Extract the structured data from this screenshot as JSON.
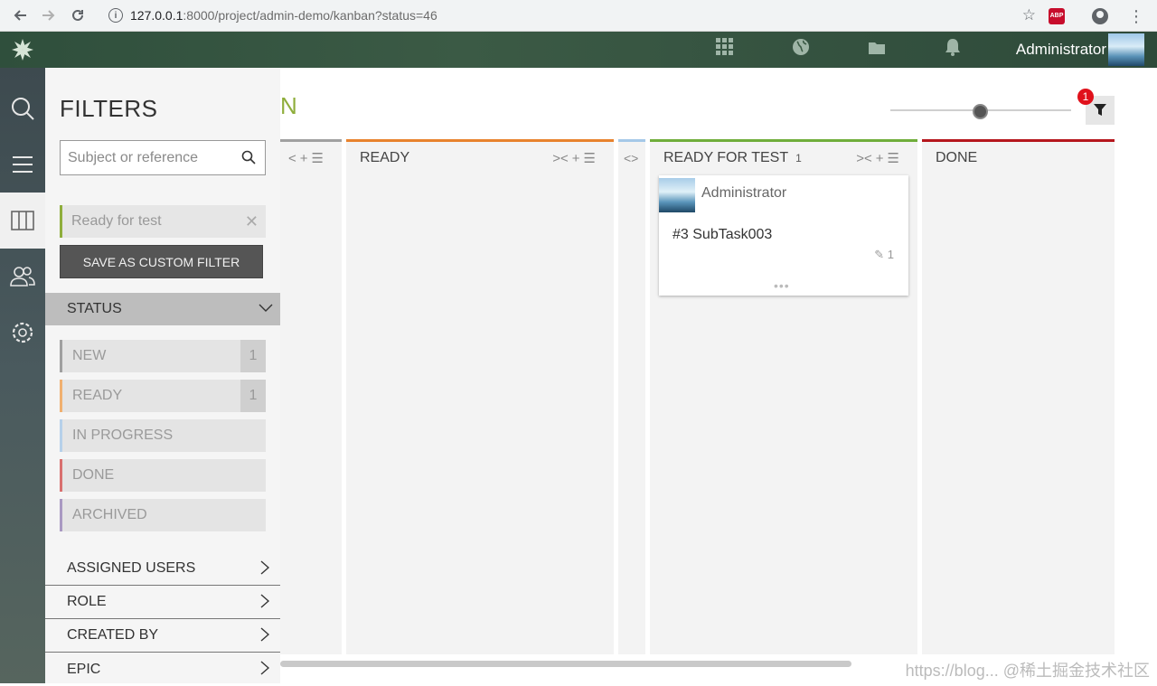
{
  "browser": {
    "url_host": "127.0.0.1",
    "url_path": ":8000/project/admin-demo/kanban?status=46",
    "info_icon": "info-icon",
    "star_icon": "star-icon",
    "adblock_label": "ABP"
  },
  "topbar": {
    "user_name": "Administrator",
    "icons": [
      "apps-grid-icon",
      "globe-icon",
      "folder-icon",
      "bell-icon"
    ]
  },
  "leftnav": {
    "items": [
      "search-icon",
      "menu-icon",
      "kanban-icon",
      "team-icon",
      "settings-icon"
    ]
  },
  "kanban": {
    "title_fragment": "N",
    "filter_badge": "1",
    "columns": [
      {
        "name": "",
        "color": "#a0a0a0"
      },
      {
        "name": "READY",
        "color": "#e8822d"
      },
      {
        "name": "",
        "color": "#a5c8e8"
      },
      {
        "name": "READY FOR TEST",
        "count": "1",
        "color": "#6fad3a"
      },
      {
        "name": "DONE",
        "color": "#b5161c"
      }
    ],
    "card": {
      "user": "Administrator",
      "title": "#3 SubTask003",
      "attachments": "1",
      "more": "•••"
    }
  },
  "filters": {
    "title": "FILTERS",
    "search_placeholder": "Subject or reference",
    "applied_filter": "Ready for test",
    "save_button": "SAVE AS CUSTOM FILTER",
    "status_section": "STATUS",
    "statuses": [
      {
        "label": "NEW",
        "count": "1",
        "color": "#a0a0a0"
      },
      {
        "label": "READY",
        "count": "1",
        "color": "#f0b070"
      },
      {
        "label": "IN PROGRESS",
        "count": "",
        "color": "#b6d0ea"
      },
      {
        "label": "DONE",
        "count": "",
        "color": "#d9706f"
      },
      {
        "label": "ARCHIVED",
        "count": "",
        "color": "#a999c2"
      }
    ],
    "sections": [
      "ASSIGNED USERS",
      "ROLE",
      "CREATED BY",
      "EPIC"
    ]
  },
  "watermark": "https://blog... @稀土掘金技术社区"
}
